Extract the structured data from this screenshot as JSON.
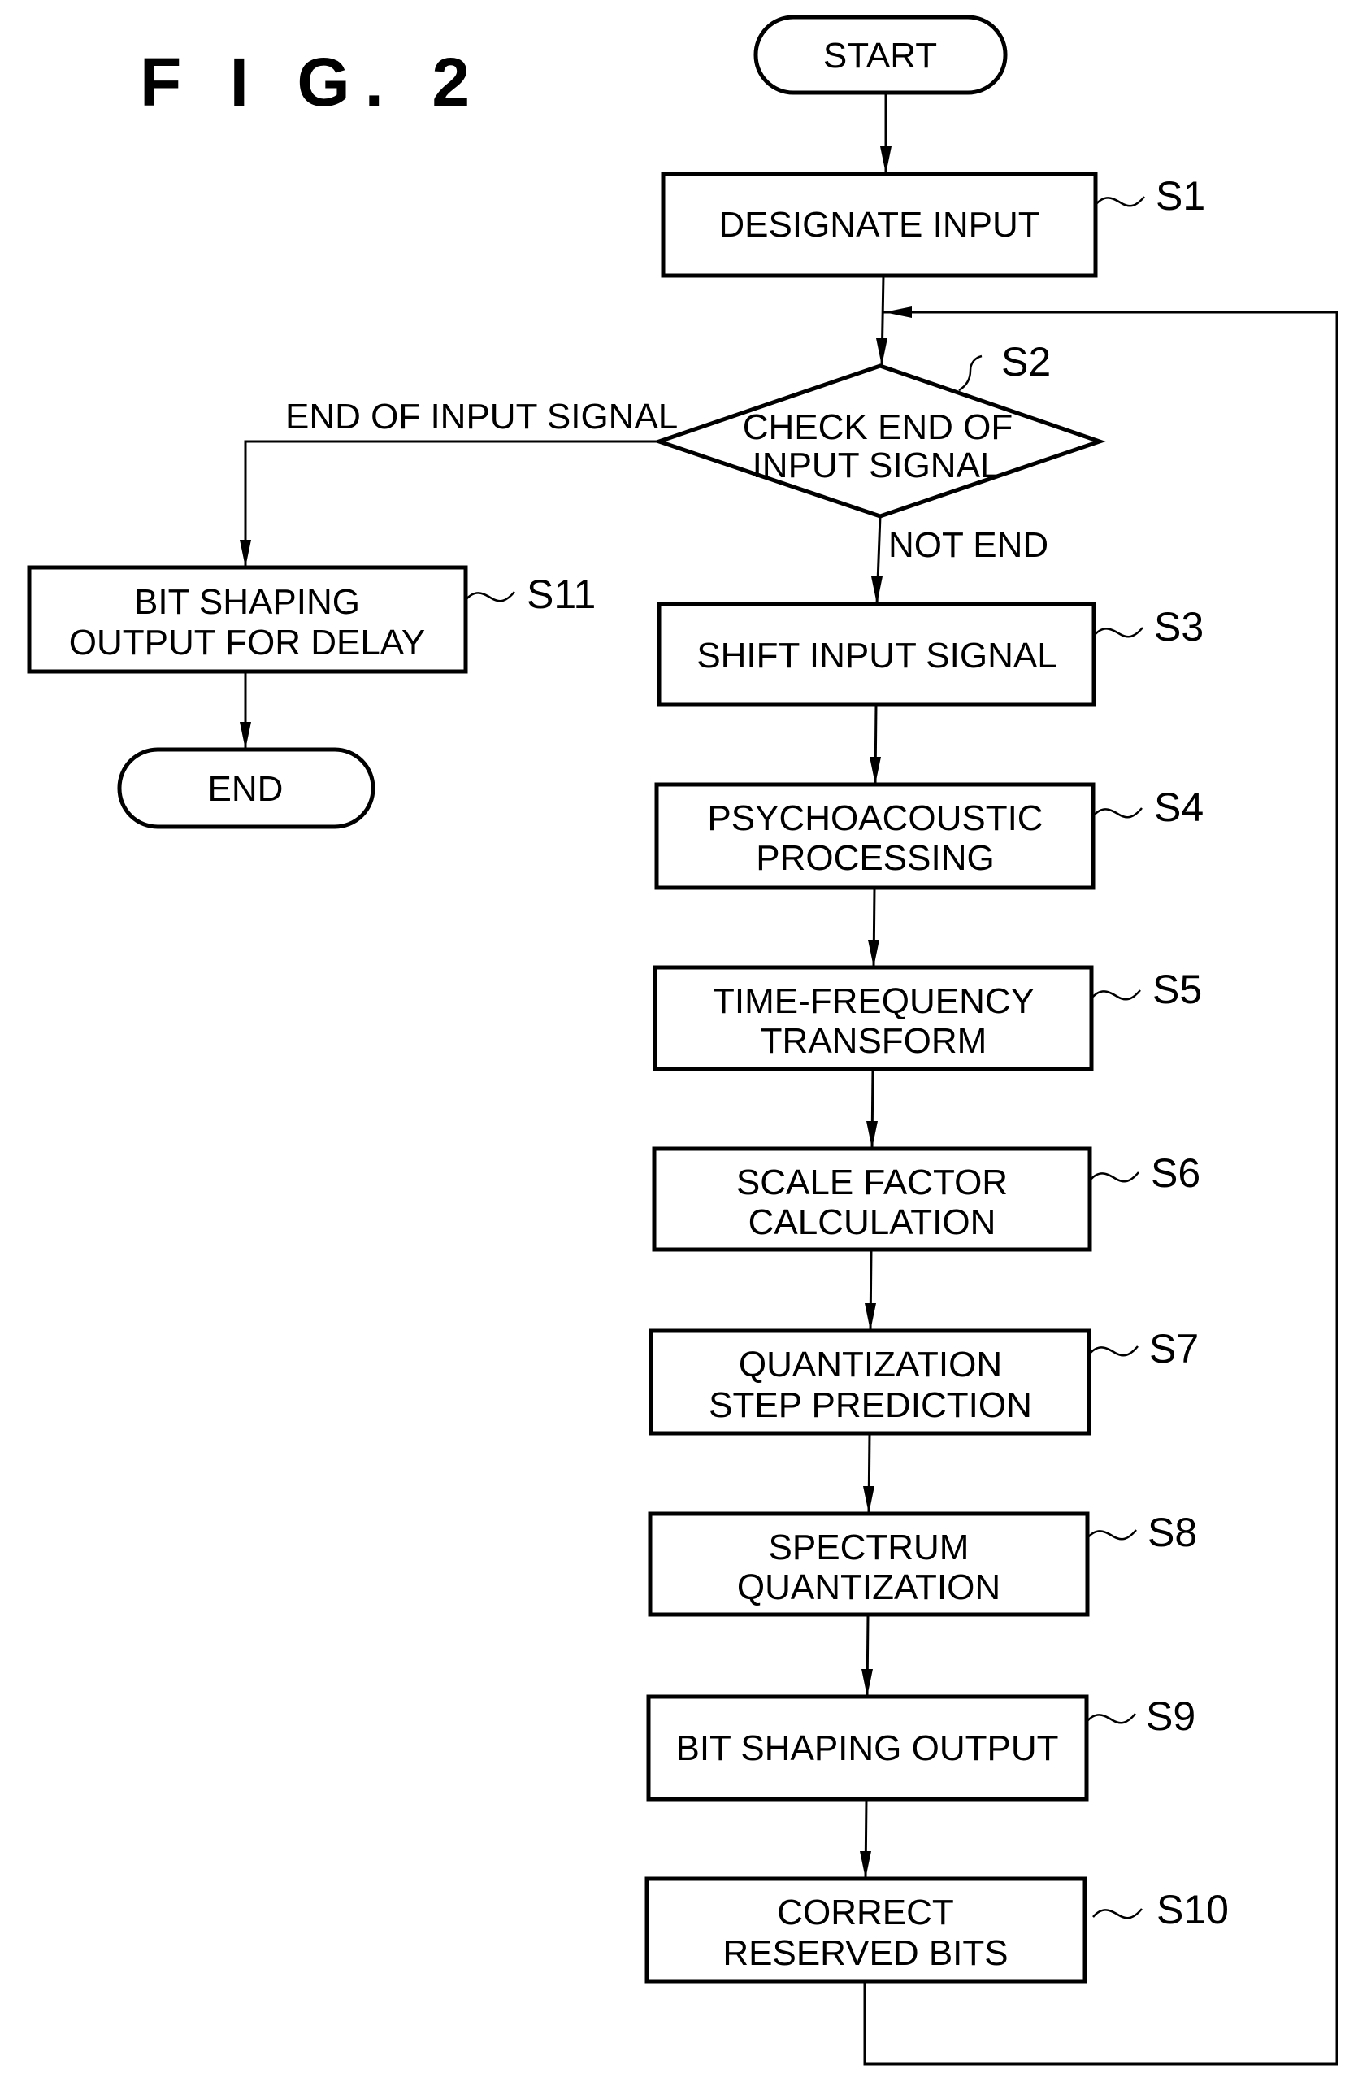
{
  "figure": {
    "title": "F I G. 2"
  },
  "terminals": {
    "start": "START",
    "end": "END"
  },
  "steps": [
    {
      "id": "S1",
      "label": "S1",
      "lines": [
        "DESIGNATE INPUT"
      ]
    },
    {
      "id": "S2",
      "label": "S2",
      "lines": [
        "CHECK END OF",
        "INPUT SIGNAL"
      ],
      "type": "decision"
    },
    {
      "id": "S3",
      "label": "S3",
      "lines": [
        "SHIFT INPUT SIGNAL"
      ]
    },
    {
      "id": "S4",
      "label": "S4",
      "lines": [
        "PSYCHOACOUSTIC",
        "PROCESSING"
      ]
    },
    {
      "id": "S5",
      "label": "S5",
      "lines": [
        "TIME-FREQUENCY",
        "TRANSFORM"
      ]
    },
    {
      "id": "S6",
      "label": "S6",
      "lines": [
        "SCALE FACTOR",
        "CALCULATION"
      ]
    },
    {
      "id": "S7",
      "label": "S7",
      "lines": [
        "QUANTIZATION",
        "STEP PREDICTION"
      ]
    },
    {
      "id": "S8",
      "label": "S8",
      "lines": [
        "SPECTRUM",
        "QUANTIZATION"
      ]
    },
    {
      "id": "S9",
      "label": "S9",
      "lines": [
        "BIT SHAPING OUTPUT"
      ]
    },
    {
      "id": "S10",
      "label": "S10",
      "lines": [
        "CORRECT",
        "RESERVED BITS"
      ]
    },
    {
      "id": "S11",
      "label": "S11",
      "lines": [
        "BIT SHAPING",
        "OUTPUT FOR DELAY"
      ]
    }
  ],
  "edges": {
    "end_branch": "END OF INPUT SIGNAL",
    "not_end_branch": "NOT END"
  }
}
